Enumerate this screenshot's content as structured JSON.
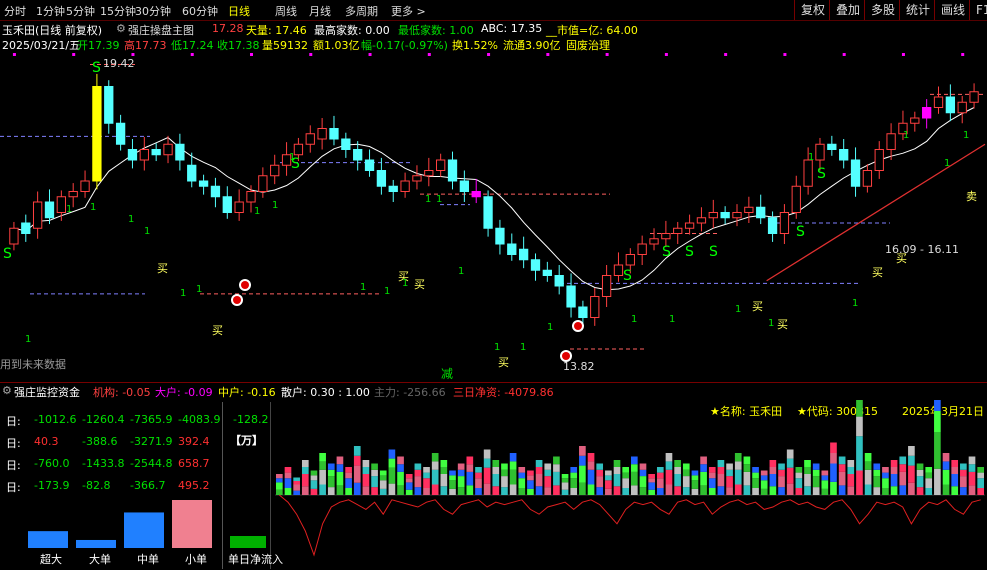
{
  "toolbar": {
    "periods": [
      "分时",
      "1分钟",
      "5分钟",
      "15分钟",
      "30分钟",
      "60分钟",
      "日线",
      "周线",
      "月线",
      "多周期",
      "更多 >"
    ],
    "active": "日线",
    "right_buttons": [
      "复权",
      "叠加",
      "多股",
      "统计",
      "画线",
      "F10"
    ]
  },
  "main": {
    "stock_title": "玉禾田(日线 前复权)",
    "indicator_name": "强庄操盘主图",
    "v1": "17.28",
    "tianliang": "天量: 17.46",
    "zuigao": "最高家数: 0.00",
    "zuidi": "最低家数: 1.00",
    "abc": "ABC: 17.35",
    "shizhi": "__市值=亿: 64.00",
    "date": "2025/03/21/五",
    "open": "开17.39",
    "high": "高17.73",
    "low": "低17.24",
    "close": "收17.38",
    "vol": "量59132",
    "amount": "额1.03亿",
    "change": "幅-0.17(-0.97%)",
    "turnover": "换1.52%",
    "float": "流通3.90亿",
    "sector": "固废治理",
    "high_label": "19.42",
    "low_label": "13.82",
    "range_label": "16.09 - 16.11",
    "future_text": "用到未来数据",
    "jian": "减",
    "buy": "买",
    "sell": "卖",
    "s": "S",
    "one": "1"
  },
  "sub": {
    "title": "强庄监控资金",
    "jigou": "机构: -0.05",
    "dahu": "大户: -0.09",
    "zhonghu": "中户: -0.16",
    "sanhu": "散户: 0.30 : 1.00",
    "zhuli": "主力: -256.66",
    "jingzi": "三日净资: -4079.86",
    "name_label": "★名称: 玉禾田",
    "code_label": "★代码: 300815",
    "date_label": "2025年3月21日",
    "row_labels": [
      "日:",
      "日:",
      "日:",
      "日:"
    ],
    "rows": [
      [
        "-1012.6",
        "-1260.4",
        "-7365.9",
        "-4083.9"
      ],
      [
        "40.3",
        "-388.6",
        "-3271.9",
        "392.4"
      ],
      [
        "-760.0",
        "-1433.8",
        "-2544.8",
        "658.7"
      ],
      [
        "-173.9",
        "-82.8",
        "-366.7",
        "495.2"
      ]
    ],
    "right_value": "-128.2",
    "unit": "【万】",
    "bar_labels": [
      "超大",
      "大单",
      "中单",
      "小单"
    ],
    "bar_values": [
      -173.9,
      -82.8,
      -366.7,
      495.2
    ],
    "net_label": "单日净流入"
  },
  "chart_data": {
    "type": "candlestick",
    "price_range": [
      13.82,
      19.42
    ],
    "note_series": "daily OHLC approximated",
    "close": [
      16.3,
      16.2,
      16.8,
      16.5,
      16.9,
      17.0,
      17.2,
      19.0,
      18.3,
      17.9,
      17.6,
      17.8,
      17.7,
      17.9,
      17.6,
      17.2,
      17.1,
      16.9,
      16.6,
      16.8,
      17.0,
      17.3,
      17.5,
      17.7,
      17.9,
      18.1,
      18.2,
      18.0,
      17.8,
      17.6,
      17.4,
      17.1,
      17.0,
      17.2,
      17.3,
      17.4,
      17.6,
      17.2,
      17.0,
      16.9,
      16.3,
      16.0,
      15.8,
      15.7,
      15.5,
      15.4,
      15.2,
      14.8,
      14.6,
      15.0,
      15.4,
      15.6,
      15.8,
      16.0,
      16.1,
      16.2,
      16.3,
      16.4,
      16.5,
      16.6,
      16.5,
      16.6,
      16.7,
      16.5,
      16.2,
      16.6,
      17.1,
      17.6,
      17.9,
      17.8,
      17.6,
      17.1,
      17.4,
      17.8,
      18.1,
      18.3,
      18.4,
      18.6,
      18.8,
      18.5,
      18.7,
      18.9
    ],
    "open": [
      16.0,
      16.4,
      16.3,
      16.8,
      16.6,
      16.9,
      17.0,
      17.2,
      19.0,
      18.3,
      17.8,
      17.6,
      17.8,
      17.7,
      17.9,
      17.5,
      17.2,
      17.1,
      16.9,
      16.6,
      16.8,
      17.0,
      17.3,
      17.5,
      17.7,
      17.9,
      18.0,
      18.2,
      18.0,
      17.8,
      17.6,
      17.4,
      17.1,
      17.0,
      17.2,
      17.3,
      17.4,
      17.6,
      17.2,
      17.0,
      16.9,
      16.3,
      16.0,
      15.9,
      15.7,
      15.5,
      15.4,
      15.2,
      14.8,
      14.6,
      15.0,
      15.4,
      15.6,
      15.8,
      16.0,
      16.1,
      16.2,
      16.3,
      16.4,
      16.5,
      16.6,
      16.5,
      16.6,
      16.7,
      16.5,
      16.2,
      16.6,
      17.1,
      17.6,
      17.9,
      17.8,
      17.6,
      17.1,
      17.4,
      17.8,
      18.1,
      18.3,
      18.4,
      18.6,
      18.8,
      18.5,
      18.7
    ],
    "flow_pos": [
      6,
      8,
      5,
      10,
      7,
      12,
      9,
      11,
      8,
      14,
      10,
      9,
      7,
      13,
      11,
      6,
      9,
      8,
      12,
      10,
      7,
      9,
      11,
      8,
      13,
      10,
      9,
      12,
      8,
      7,
      10,
      9,
      11,
      6,
      8,
      14,
      12,
      9,
      7,
      10,
      8,
      11,
      9,
      6,
      8,
      12,
      10,
      9,
      7,
      11,
      8,
      10,
      9,
      12,
      11,
      8,
      7,
      10,
      9,
      13,
      8,
      10,
      9,
      7,
      15,
      11,
      10,
      28,
      12,
      9,
      8,
      10,
      11,
      14,
      9,
      8,
      30,
      12,
      10,
      9,
      11,
      8
    ],
    "flow_line": [
      0,
      -3,
      -8,
      -15,
      -25,
      -12,
      -5,
      -3,
      -2,
      -4,
      -6,
      -3,
      -8,
      -2,
      -3,
      -4,
      -5,
      -3,
      -2,
      -6,
      -8,
      -4,
      -3,
      -2,
      -5,
      -3,
      -4,
      -3,
      -2,
      -6,
      -8,
      -5,
      -4,
      -3,
      -6,
      -3,
      -2,
      -4,
      -8,
      -12,
      -6,
      -3,
      -4,
      -3,
      -6,
      -8,
      -3,
      -2,
      -4,
      -3,
      -8,
      -5,
      -3,
      -2,
      -4,
      -3,
      -6,
      -5,
      -3,
      -2,
      -4,
      -3,
      -5,
      -6,
      -3,
      -2,
      -6,
      -12,
      -8,
      -3,
      -4,
      -3,
      -5,
      -12,
      -6,
      -3,
      -4,
      -2,
      -6,
      -8,
      -3,
      -2
    ]
  }
}
